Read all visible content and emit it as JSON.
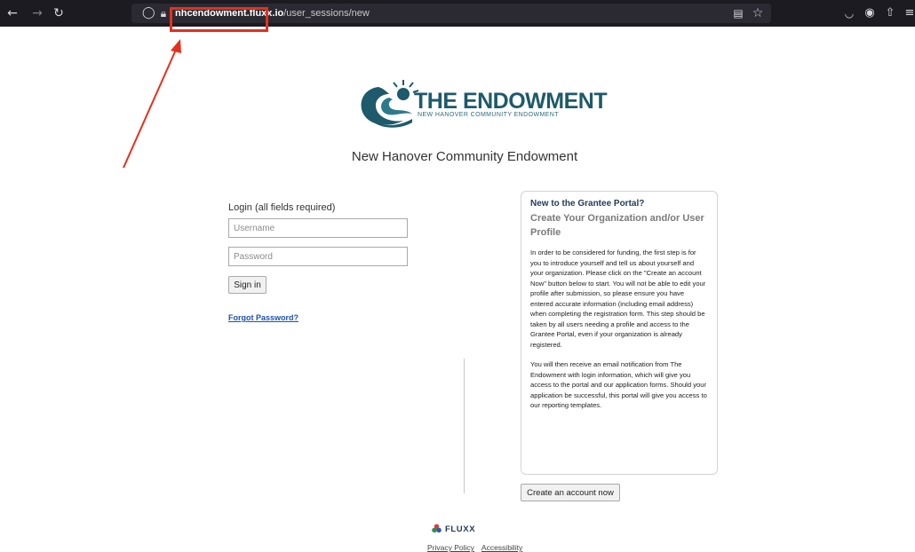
{
  "browser": {
    "url_host": "nhcendowment.fluxx.io",
    "url_path": "/user_sessions/new",
    "back_icon": "arrow-left-icon",
    "forward_icon": "arrow-right-icon",
    "reload_icon": "reload-icon"
  },
  "logo": {
    "title": "THE ENDOWMENT",
    "subtitle": "NEW HANOVER COMMUNITY ENDOWMENT",
    "brand_color": "#1d5a6b"
  },
  "org_title": "New Hanover Community Endowment",
  "login": {
    "label": "Login (all fields required)",
    "username_placeholder": "Username",
    "password_placeholder": "Password",
    "signin_label": "Sign in",
    "forgot_label": "Forgot Password?"
  },
  "panel": {
    "heading": "New to the Grantee Portal?",
    "subheading": "Create Your Organization and/or User Profile",
    "paragraph1": "In order to be considered for funding, the first step is for you to introduce yourself and tell us about yourself and your organization. Please click on the \"Create an account Now\" button below to start. You will not be able to edit your profile after submission, so please ensure you have entered accurate information (including email address) when completing the registration form. This step should be taken by all users needing a profile and access to the Grantee Portal, even if your organization is already registered.",
    "paragraph2": "You will then receive an email notification from The Endowment with login information, which will give you access to the portal and our application forms. Should your application be successful, this portal will give you access to our reporting templates."
  },
  "create_account_label": "Create an account now",
  "footer": {
    "brand": "FLUXX",
    "privacy": "Privacy Policy",
    "accessibility": "Accessibility"
  },
  "colors": {
    "highlight": "#e4301c",
    "link": "#1a51b8"
  }
}
